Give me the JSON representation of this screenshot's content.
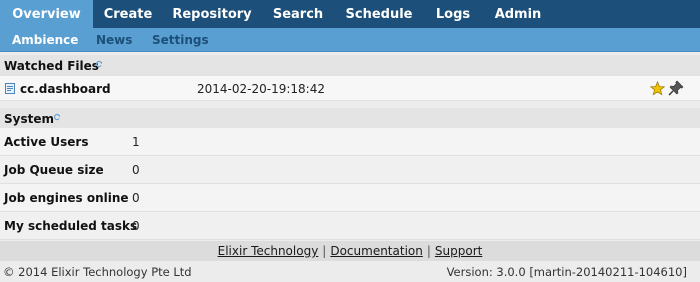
{
  "topnav": {
    "tabs": [
      {
        "label": "Overview",
        "active": true
      },
      {
        "label": "Create"
      },
      {
        "label": "Repository"
      },
      {
        "label": "Search"
      },
      {
        "label": "Schedule"
      },
      {
        "label": "Logs"
      },
      {
        "label": "Admin"
      }
    ]
  },
  "subnav": {
    "items": [
      {
        "label": "Ambience",
        "active": true
      },
      {
        "label": "News"
      },
      {
        "label": "Settings"
      }
    ]
  },
  "watched": {
    "title": "Watched Files",
    "files": [
      {
        "name": "cc.dashboard",
        "date": "2014-02-20-19:18:42"
      }
    ]
  },
  "system": {
    "title": "System",
    "rows": [
      {
        "label": "Active Users",
        "value": "1"
      },
      {
        "label": "Job Queue size",
        "value": "0"
      },
      {
        "label": "Job engines online",
        "value": "0"
      },
      {
        "label": "My scheduled tasks",
        "value": "0"
      }
    ]
  },
  "footer": {
    "links": [
      "Elixir Technology",
      "Documentation",
      "Support"
    ],
    "separator": "|",
    "copyright": "© 2014 Elixir Technology Pte Ltd",
    "version": "Version: 3.0.0 [martin-20140211-104610]"
  },
  "colors": {
    "nav_bg": "#1c4f79",
    "nav_active": "#5a9fd2",
    "subnav_text": "#1c4f79",
    "star": "#f2c200"
  },
  "icons": {
    "refresh": "refresh-icon",
    "file": "file-icon",
    "favorite": "star-icon",
    "pin": "pin-icon"
  }
}
